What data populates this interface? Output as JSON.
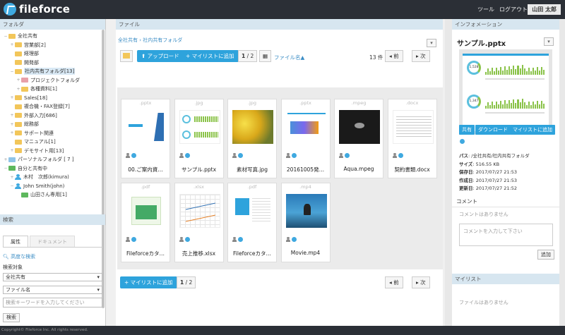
{
  "header": {
    "brand": "fileforce",
    "links": [
      "ツール",
      "ログアウト"
    ],
    "user": "山田 太郎"
  },
  "left": {
    "title": "フォルダ",
    "tree": [
      {
        "depth": 0,
        "tw": "−",
        "icon": "folder",
        "label": "全社共有"
      },
      {
        "depth": 1,
        "tw": "+",
        "icon": "folder",
        "label": "営業部[2]"
      },
      {
        "depth": 1,
        "tw": "",
        "icon": "folder",
        "label": "経理部"
      },
      {
        "depth": 1,
        "tw": "",
        "icon": "folder",
        "label": "開発部"
      },
      {
        "depth": 1,
        "tw": "−",
        "icon": "folder",
        "label": "社内共有フォルダ[13]",
        "selected": true
      },
      {
        "depth": 2,
        "tw": "+",
        "icon": "folder-pink",
        "label": "プロジェクトフォルダ"
      },
      {
        "depth": 2,
        "tw": "+",
        "icon": "folder",
        "label": "各種資料[1]"
      },
      {
        "depth": 1,
        "tw": "+",
        "icon": "folder",
        "label": "Sales[18]"
      },
      {
        "depth": 1,
        "tw": "",
        "icon": "folder",
        "label": "複合機・FAX登録[7]"
      },
      {
        "depth": 1,
        "tw": "+",
        "icon": "folder",
        "label": "外部入力[686]"
      },
      {
        "depth": 1,
        "tw": "+",
        "icon": "folder",
        "label": "総務部"
      },
      {
        "depth": 1,
        "tw": "+",
        "icon": "folder",
        "label": "サポート関連"
      },
      {
        "depth": 1,
        "tw": "",
        "icon": "folder",
        "label": "マニュアル[1]"
      },
      {
        "depth": 1,
        "tw": "+",
        "icon": "folder",
        "label": "デモサイト用[13]"
      },
      {
        "depth": 0,
        "tw": "+",
        "icon": "folder-blue",
        "label": "パーソナルフォルダ [ 7 ]"
      },
      {
        "depth": 0,
        "tw": "−",
        "icon": "folder-green",
        "label": "自分と共有中"
      },
      {
        "depth": 1,
        "tw": "+",
        "icon": "person",
        "label": "木村　次郎(kimura)"
      },
      {
        "depth": 1,
        "tw": "−",
        "icon": "person",
        "label": "John Smith(john)"
      },
      {
        "depth": 2,
        "tw": "",
        "icon": "folder-green",
        "label": "山田さん専用[1]"
      }
    ],
    "search": {
      "title": "検索",
      "tab_attr": "属性",
      "tab_doc": "ドキュメント",
      "advanced": "高度な検索",
      "target_label": "検索対象",
      "target_value": "全社共有",
      "field_value": "ファイル名",
      "keyword_placeholder": "検索キーワードを入力してください",
      "search_button": "検索"
    }
  },
  "center": {
    "title": "ファイル",
    "breadcrumb": "全社共有 › 社内共有フォルダ",
    "upload": "アップロード",
    "add_mylist": "マイリストに追加",
    "page": "1",
    "page_total": "/ 2",
    "sort": "ファイル名▲",
    "count": "13 件",
    "prev": "前",
    "next": "次",
    "files": [
      {
        "ext": ".pptx",
        "name": "00.ご案内資…",
        "thumb": "pptx1"
      },
      {
        "ext": ".jpg",
        "name": "サンプル.pptx",
        "thumb": "dash"
      },
      {
        "ext": ".jpg",
        "name": "素材写真.jpg",
        "thumb": "yellow"
      },
      {
        "ext": ".pptx",
        "name": "20161005発…",
        "thumb": "pptx2"
      },
      {
        "ext": ".mpeg",
        "name": "Aqua.mpeg",
        "thumb": "dark"
      },
      {
        "ext": ".docx",
        "name": "契約書類.docx",
        "thumb": "doc"
      },
      {
        "ext": ".pdf",
        "name": "Fileforceカタ…",
        "thumb": "pdf1"
      },
      {
        "ext": ".xlsx",
        "name": "売上推移.xlsx",
        "thumb": "xlsx"
      },
      {
        "ext": ".pdf",
        "name": "Fileforceカタ…",
        "thumb": "pdf2"
      },
      {
        "ext": ".mp4",
        "name": "Movie.mp4",
        "thumb": "movie"
      }
    ]
  },
  "right": {
    "title": "インフォメーション",
    "file_title": "サンプル.pptx",
    "buttons": [
      "共有",
      "ダウンロード",
      "マイリストに追加"
    ],
    "meta": [
      {
        "k": "パス",
        "v": "/全社共有/社内共有フォルダ"
      },
      {
        "k": "サイズ",
        "v": "516.55 KB"
      },
      {
        "k": "保存日",
        "v": "2017/07/27 21:53"
      },
      {
        "k": "作成日",
        "v": "2017/07/27 21:53"
      },
      {
        "k": "更新日",
        "v": "2017/07/27 21:52"
      }
    ],
    "comment_title": "コメント",
    "comment_empty": "コメントはありません",
    "comment_placeholder": "コメントを入力して下さい",
    "comment_add": "追加",
    "mylist_title": "マイリスト",
    "mylist_empty": "ファイルはありません",
    "preview_stats": [
      "1,528",
      "1,347"
    ]
  },
  "footer": "Copyright© Fileforce Inc. All rights reserved.",
  "colors": {
    "accent": "#2ea3dc",
    "header": "#2b2f36",
    "panel_header": "#d7e6f0"
  }
}
